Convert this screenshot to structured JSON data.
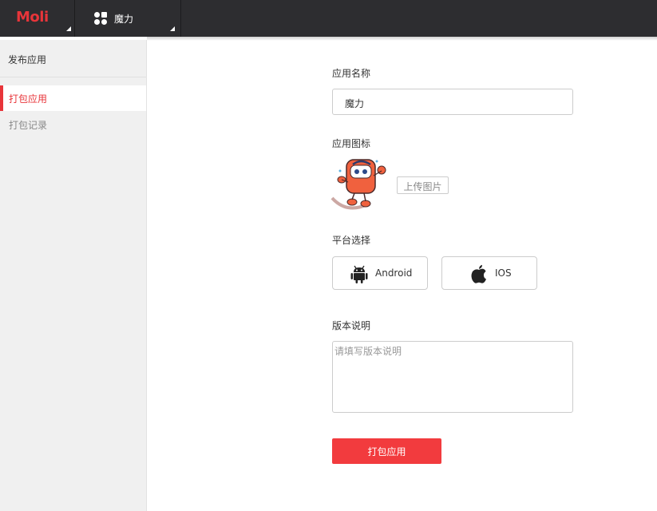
{
  "header": {
    "logo": "Moli",
    "app_name": "魔力"
  },
  "sidebar": {
    "title": "发布应用",
    "items": [
      {
        "label": "打包应用",
        "active": true
      },
      {
        "label": "打包记录",
        "active": false
      }
    ]
  },
  "form": {
    "app_name_label": "应用名称",
    "app_name_value": "魔力",
    "app_icon_label": "应用图标",
    "upload_label": "上传图片",
    "platform_label": "平台选择",
    "platforms": [
      {
        "name": "Android",
        "icon": "android-icon"
      },
      {
        "name": "IOS",
        "icon": "apple-icon"
      }
    ],
    "version_label": "版本说明",
    "version_placeholder": "请填写版本说明",
    "submit_label": "打包应用"
  },
  "colors": {
    "accent": "#e8353a",
    "header_bg": "#2d2d30",
    "sidebar_bg": "#f0f0f0",
    "button_bg": "#f23b3e"
  }
}
